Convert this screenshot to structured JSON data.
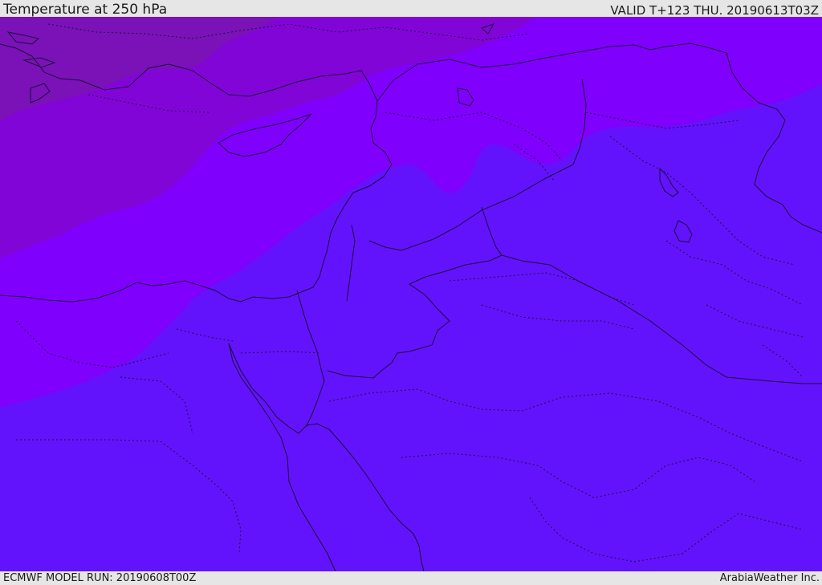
{
  "header": {
    "title": "Temperature at 250 hPa",
    "valid": "VALID T+123 THU. 20190613T03Z"
  },
  "footer": {
    "model_run": "ECMWF MODEL RUN: 20190608T00Z",
    "credit": "ArabiaWeather Inc."
  },
  "map": {
    "colors": {
      "band_coldest": "#7a12b8",
      "band_cold": "#8205d8",
      "band_mid": "#8000fd",
      "band_warm": "#6313fc",
      "border_line": "#1b0c3a"
    }
  }
}
